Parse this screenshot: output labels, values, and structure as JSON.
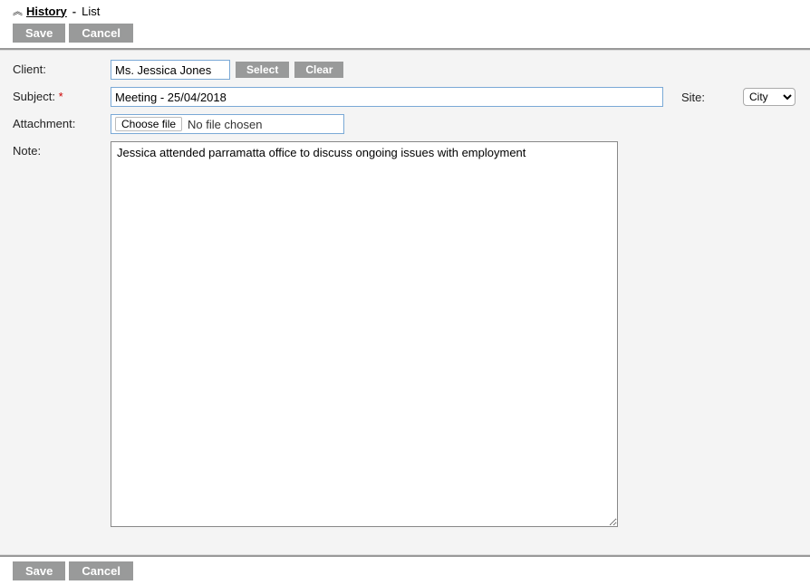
{
  "breadcrumb": {
    "history": "History",
    "dash": "-",
    "current": "List"
  },
  "toolbar": {
    "save_label": "Save",
    "cancel_label": "Cancel"
  },
  "form": {
    "client": {
      "label": "Client:",
      "value": "Ms. Jessica Jones",
      "select_label": "Select",
      "clear_label": "Clear"
    },
    "subject": {
      "label": "Subject:",
      "required_mark": "*",
      "value": "Meeting - 25/04/2018"
    },
    "site": {
      "label": "Site:",
      "value": "City",
      "options": [
        "City"
      ]
    },
    "attachment": {
      "label": "Attachment:",
      "choose_label": "Choose file",
      "status": "No file chosen"
    },
    "note": {
      "label": "Note:",
      "value": "Jessica attended parramatta office to discuss ongoing issues with employment"
    }
  }
}
